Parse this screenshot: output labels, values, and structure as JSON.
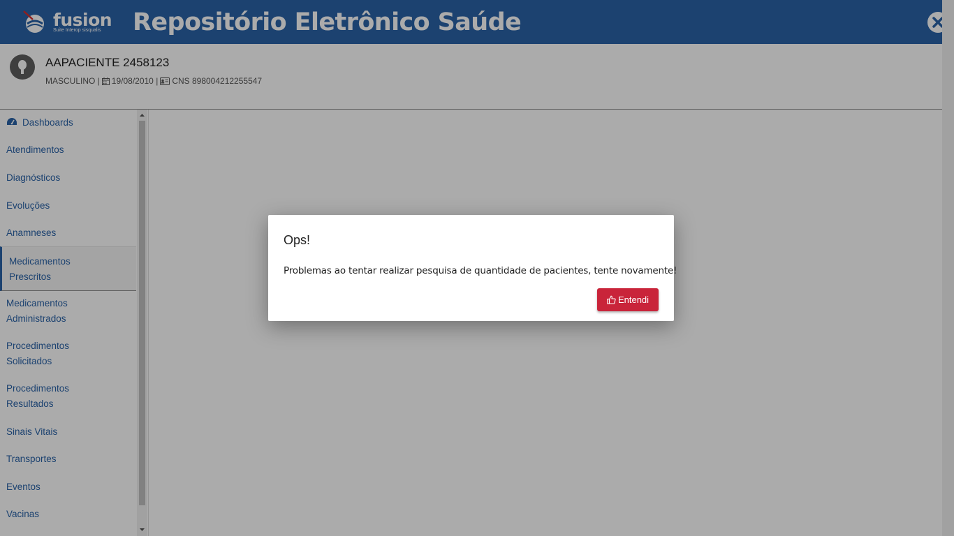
{
  "header": {
    "logo_text": "fusion",
    "logo_subtitle": "Suite Interop sisqualis",
    "title": "Repositório Eletrônico Saúde"
  },
  "patient": {
    "name": "AAPACIENTE 2458123",
    "sex": "MASCULINO |",
    "birth_date": "19/08/2010 |",
    "cns": "CNS 898004212255547"
  },
  "sidebar": {
    "items": [
      {
        "label": "Dashboards",
        "icon": "tachometer-icon"
      },
      {
        "label": "Atendimentos"
      },
      {
        "label": "Diagnósticos"
      },
      {
        "label": "Evoluções"
      },
      {
        "label": "Anamneses"
      },
      {
        "label": "Medicamentos Prescritos",
        "active": true
      },
      {
        "label": "Medicamentos Administrados"
      },
      {
        "label": "Procedimentos Solicitados"
      },
      {
        "label": "Procedimentos Resultados"
      },
      {
        "label": "Sinais Vitais"
      },
      {
        "label": "Transportes"
      },
      {
        "label": "Eventos"
      },
      {
        "label": "Vacinas"
      }
    ]
  },
  "modal": {
    "title": "Ops!",
    "message": "Problemas ao tentar realizar pesquisa de quantidade de pacientes, tente novamente!",
    "button_label": "Entendi"
  },
  "colors": {
    "header_bg": "#2a63a8",
    "link": "#2a63a8",
    "button_danger": "#c9243a"
  }
}
